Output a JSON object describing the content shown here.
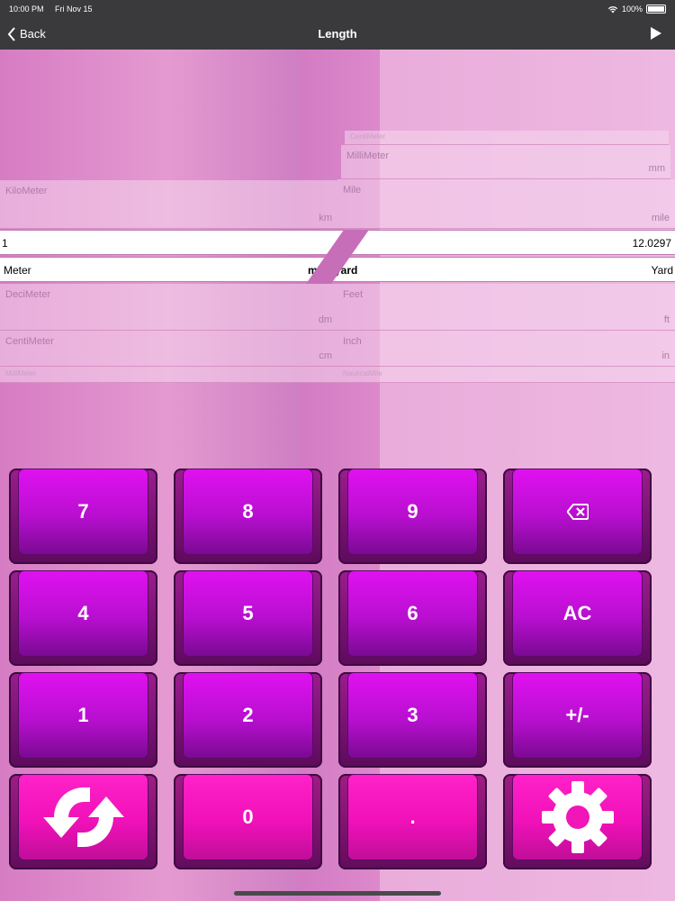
{
  "status": {
    "time": "10:00 PM",
    "date": "Fri Nov 15",
    "battery": "100%"
  },
  "nav": {
    "back_label": "Back",
    "title": "Length"
  },
  "left_picker": {
    "above_faint": "",
    "rows_above": [
      {
        "name": "KiloMeter",
        "unit": "km"
      }
    ],
    "rows_below": [
      {
        "name": "DeciMeter",
        "unit": "dm"
      },
      {
        "name": "CentiMeter",
        "unit": "cm"
      }
    ],
    "bottom_faint": "MilliMeter"
  },
  "right_picker": {
    "top_faint": "CentiMeter",
    "rows_above": [
      {
        "name": "MilliMeter",
        "unit": "mm"
      },
      {
        "name": "Mile",
        "unit": "mile"
      }
    ],
    "rows_below": [
      {
        "name": "Feet",
        "unit": "ft"
      },
      {
        "name": "Inch",
        "unit": "in"
      }
    ],
    "bottom_faint": "NauticalMile"
  },
  "input_value": "1",
  "result_value": "12.0297",
  "from_unit": {
    "name": "Meter",
    "symbol": "m"
  },
  "to_unit": {
    "name": "yard",
    "symbol": "Yard"
  },
  "keys": {
    "k7": "7",
    "k8": "8",
    "k9": "9",
    "k4": "4",
    "k5": "5",
    "k6": "6",
    "ac": "AC",
    "k1": "1",
    "k2": "2",
    "k3": "3",
    "sign": "+/-",
    "k0": "0",
    "dot": "."
  },
  "colors": {
    "key_purple": "#d010e8",
    "key_pink": "#f016b8",
    "nav_bg": "#3a3a3c"
  }
}
